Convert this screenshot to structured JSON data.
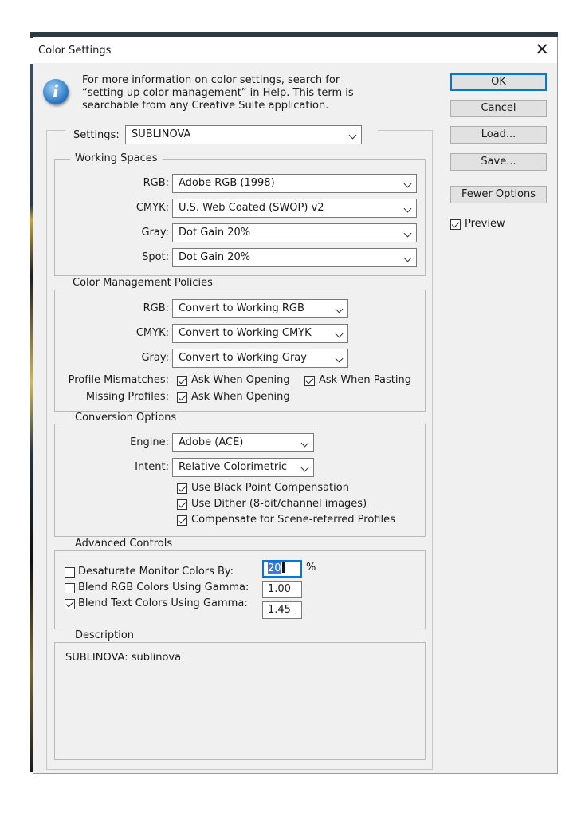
{
  "window": {
    "title": "Color Settings"
  },
  "info": {
    "line1": "For more information on color settings, search for",
    "line2": "“setting up color management” in Help. This term is",
    "line3": "searchable from any Creative Suite application."
  },
  "settings": {
    "label": "Settings:",
    "value": "SUBLINOVA"
  },
  "working_spaces": {
    "legend": "Working Spaces",
    "rows": [
      {
        "label": "RGB:",
        "value": "Adobe RGB (1998)"
      },
      {
        "label": "CMYK:",
        "value": "U.S. Web Coated (SWOP) v2"
      },
      {
        "label": "Gray:",
        "value": "Dot Gain 20%"
      },
      {
        "label": "Spot:",
        "value": "Dot Gain 20%"
      }
    ]
  },
  "policies": {
    "legend": "Color Management Policies",
    "rows": [
      {
        "label": "RGB:",
        "value": "Convert to Working RGB"
      },
      {
        "label": "CMYK:",
        "value": "Convert to Working CMYK"
      },
      {
        "label": "Gray:",
        "value": "Convert to Working Gray"
      }
    ],
    "mismatch_label": "Profile Mismatches:",
    "mismatch_opening": {
      "label": "Ask When Opening",
      "checked": true
    },
    "mismatch_pasting": {
      "label": "Ask When Pasting",
      "checked": true
    },
    "missing_label": "Missing Profiles:",
    "missing_opening": {
      "label": "Ask When Opening",
      "checked": true
    }
  },
  "conversion": {
    "legend": "Conversion Options",
    "engine_label": "Engine:",
    "engine_value": "Adobe (ACE)",
    "intent_label": "Intent:",
    "intent_value": "Relative Colorimetric",
    "options": [
      {
        "label": "Use Black Point Compensation",
        "checked": true
      },
      {
        "label": "Use Dither (8-bit/channel images)",
        "checked": true
      },
      {
        "label": "Compensate for Scene-referred Profiles",
        "checked": true
      }
    ]
  },
  "advanced": {
    "legend": "Advanced Controls",
    "desaturate": {
      "label": "Desaturate Monitor Colors By:",
      "checked": false,
      "value": "20",
      "unit": "%"
    },
    "blend_rgb": {
      "label": "Blend RGB Colors Using Gamma:",
      "checked": false,
      "value": "1.00"
    },
    "blend_text": {
      "label": "Blend Text Colors Using Gamma:",
      "checked": true,
      "value": "1.45"
    }
  },
  "description": {
    "legend": "Description",
    "text": "SUBLINOVA:  sublinova"
  },
  "buttons": {
    "ok": "OK",
    "cancel": "Cancel",
    "load": "Load...",
    "save": "Save...",
    "fewer": "Fewer Options"
  },
  "preview": {
    "label": "Preview",
    "checked": true
  },
  "colors": {
    "accent": "#0078d7",
    "selection": "#3b7bd6"
  }
}
